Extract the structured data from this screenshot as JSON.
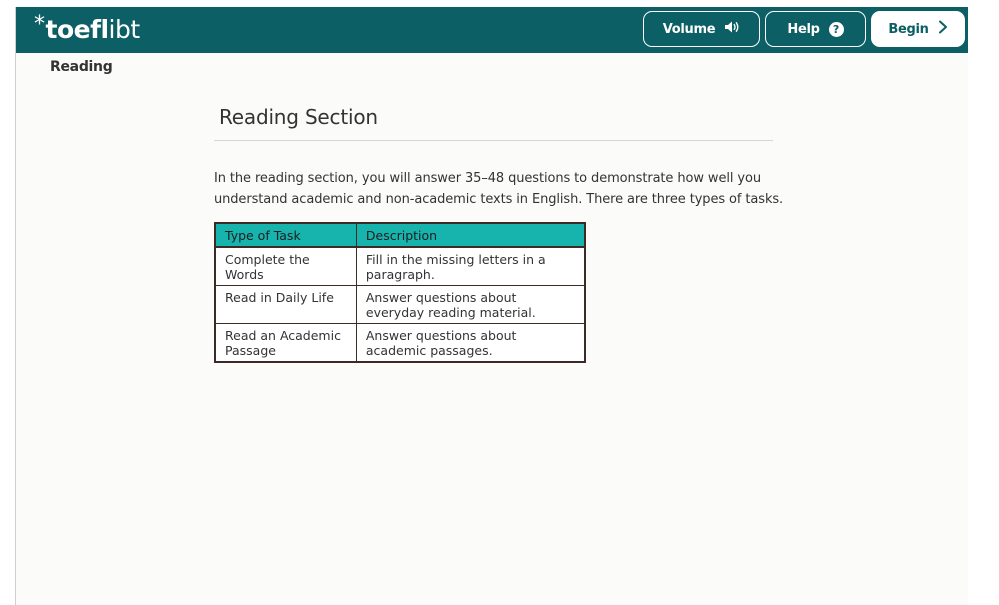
{
  "header": {
    "logo": {
      "star": "*",
      "main": "toefl",
      "suffix": "ibt"
    },
    "volume_label": "Volume",
    "help_label": "Help",
    "begin_label": "Begin",
    "help_glyph": "?"
  },
  "breadcrumb": "Reading",
  "main": {
    "title": "Reading Section",
    "intro": "In the reading section, you will answer 35–48 questions to demonstrate how well you understand academic and non-academic texts in English. There are three types of tasks.",
    "table": {
      "headers": [
        "Type of Task",
        "Description"
      ],
      "rows": [
        [
          "Complete the Words",
          "Fill in the missing letters in a paragraph."
        ],
        [
          "Read in Daily Life",
          "Answer questions about everyday reading material."
        ],
        [
          "Read an Academic Passage",
          "Answer questions about academic passages."
        ]
      ]
    }
  },
  "icons": {
    "volume": "speaker-volume-icon",
    "help": "question-circle-icon",
    "begin": "chevron-right-icon"
  },
  "colors": {
    "header_bg": "#0c5f64",
    "table_header_bg": "#17b3ad",
    "table_border": "#3b2a25"
  }
}
